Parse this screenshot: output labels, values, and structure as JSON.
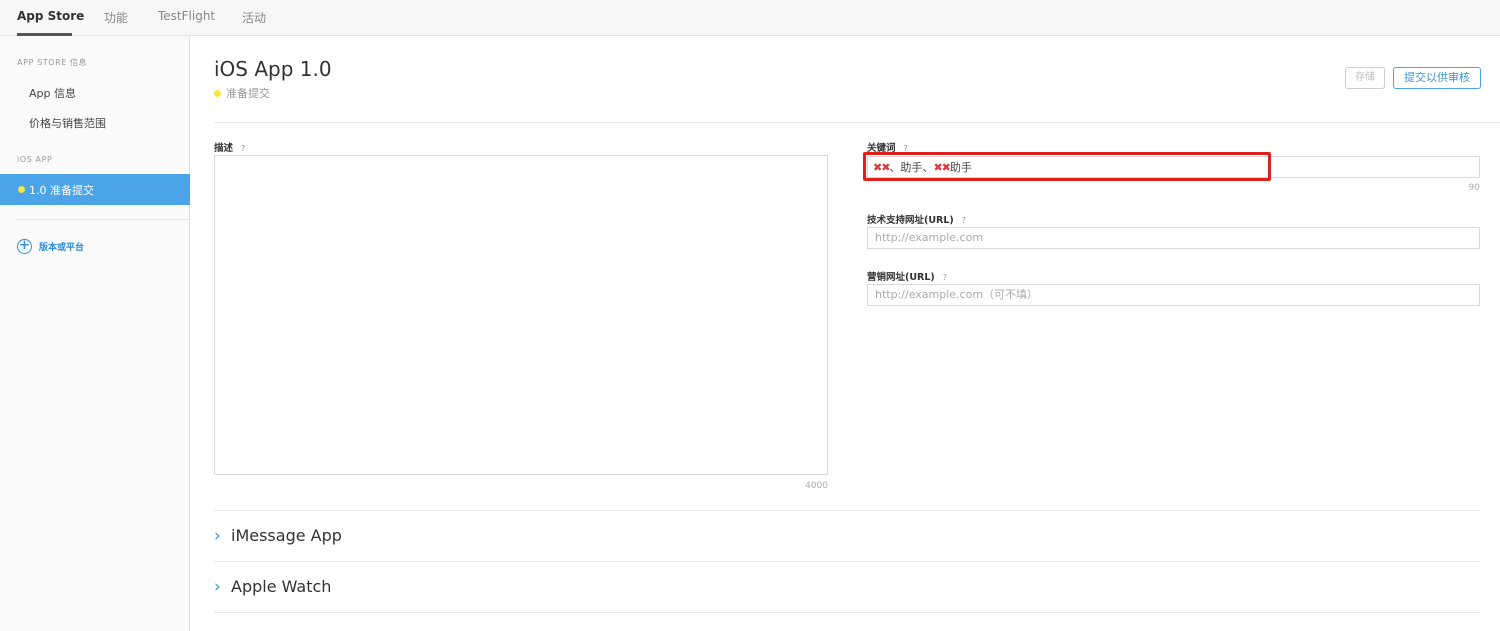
{
  "tabs": [
    "App Store",
    "功能",
    "TestFlight",
    "活动"
  ],
  "sidebar": {
    "heading_store": "APP STORE 信息",
    "items": [
      "App 信息",
      "价格与销售范围"
    ],
    "heading_ios": "iOS APP",
    "active_item": "1.0 准备提交",
    "add_label": "版本或平台"
  },
  "header": {
    "title": "iOS App 1.0",
    "status": "准备提交",
    "save_label": "存储",
    "submit_label": "提交以供审核"
  },
  "fields": {
    "description": {
      "label": "描述",
      "help": "?",
      "counter": "4000"
    },
    "keywords": {
      "label": "关键词",
      "help": "?",
      "redacted_1": "✖✖",
      "text_1": "、助手、",
      "redacted_2": "✖✖",
      "text_2": "助手",
      "counter": "90"
    },
    "support_url": {
      "label": "技术支持网址(URL)",
      "help": "?",
      "placeholder": "http://example.com"
    },
    "marketing_url": {
      "label": "营销网址(URL)",
      "help": "?",
      "placeholder": "http://example.com（可不填）"
    }
  },
  "sections": [
    "iMessage App",
    "Apple Watch"
  ],
  "colors": {
    "accent": "#4ba3e8",
    "status_dot": "#f1e94a",
    "highlight": "#e01f1f"
  }
}
